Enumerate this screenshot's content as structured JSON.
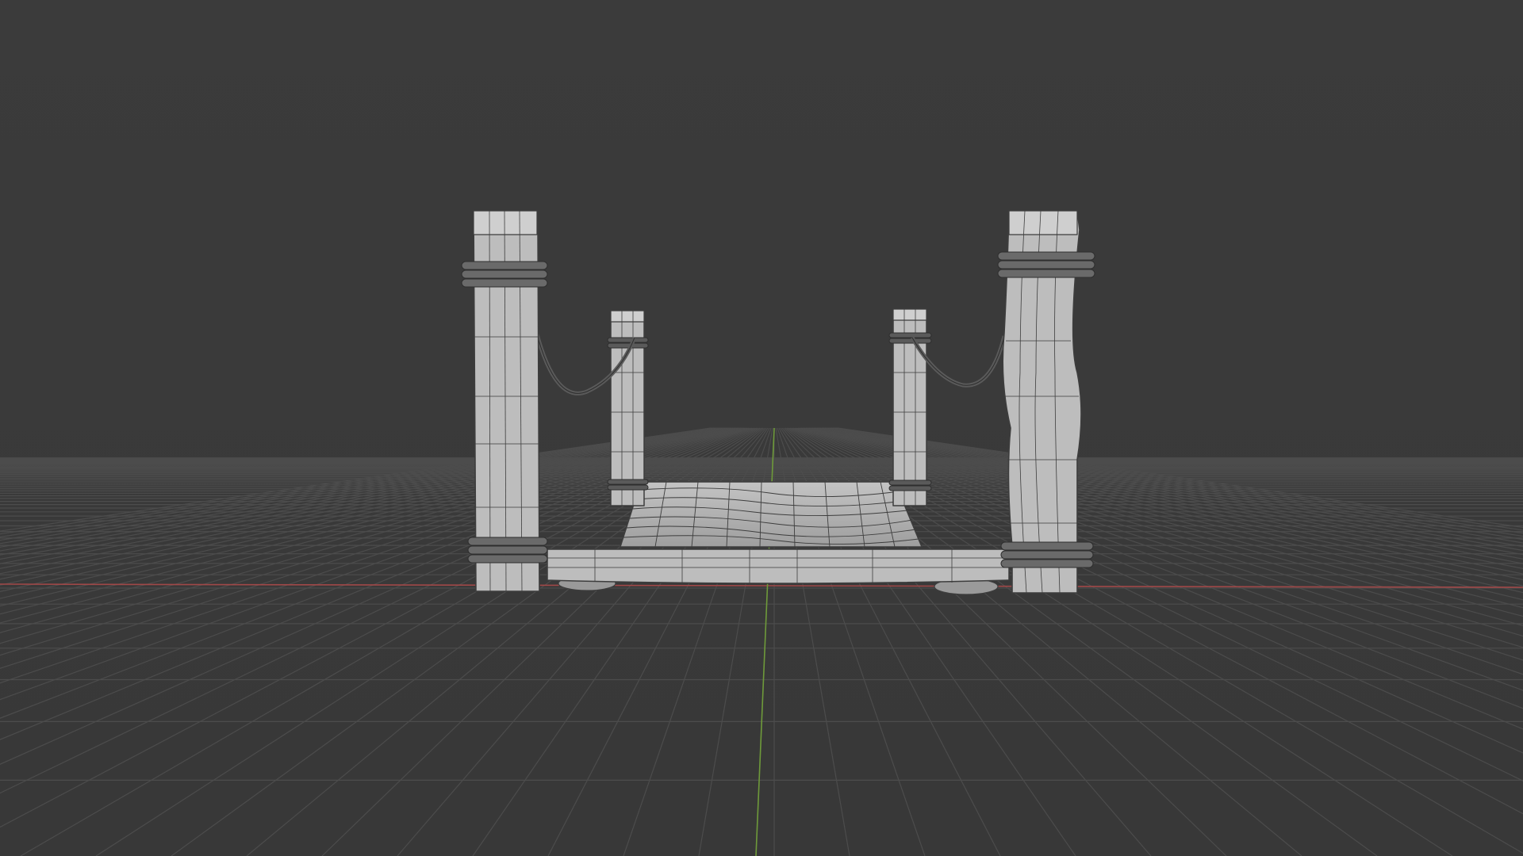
{
  "viewport": {
    "background_color": "#3a3a3a",
    "grid_color": "#4c4c4c",
    "x_axis_color": "#a04848",
    "y_axis_color": "#6e9a3a"
  },
  "scene": {
    "object_fill": "#bdbdbd",
    "object_shade": "#a9a9a9",
    "wire_color": "#3d3d3d",
    "rope_color": "#5a5a5a"
  }
}
